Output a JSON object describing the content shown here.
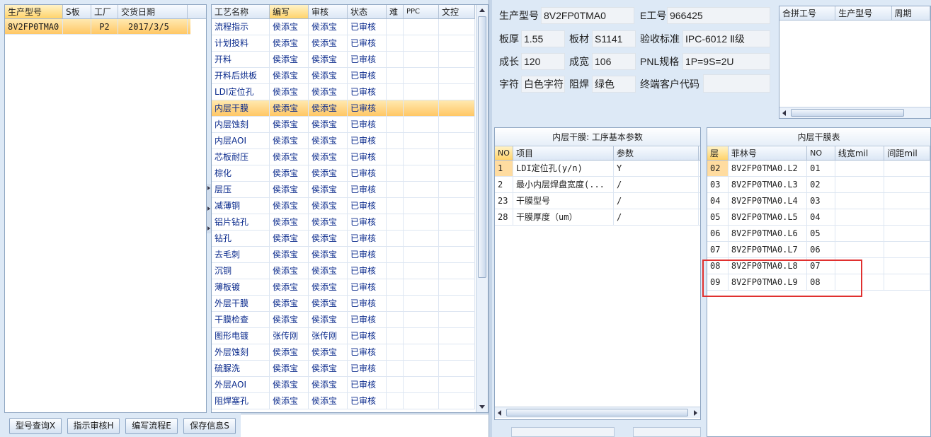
{
  "model_list": {
    "headers": [
      "生产型号",
      "S板",
      "工厂",
      "交货日期"
    ],
    "rows": [
      {
        "model": "8V2FP0TMA0",
        "s": "",
        "factory": "P2",
        "date": "2017/3/5"
      }
    ]
  },
  "process_list": {
    "headers": [
      "工艺名称",
      "编写",
      "审核",
      "状态",
      "难",
      "PPC",
      "文控"
    ],
    "rows": [
      [
        "流程指示",
        "侯添宝",
        "侯添宝",
        "已审核"
      ],
      [
        "计划投料",
        "侯添宝",
        "侯添宝",
        "已审核"
      ],
      [
        "开料",
        "侯添宝",
        "侯添宝",
        "已审核"
      ],
      [
        "开料后烘板",
        "侯添宝",
        "侯添宝",
        "已审核"
      ],
      [
        "LDI定位孔",
        "侯添宝",
        "侯添宝",
        "已审核"
      ],
      [
        "内层干膜",
        "侯添宝",
        "侯添宝",
        "已审核"
      ],
      [
        "内层蚀刻",
        "侯添宝",
        "侯添宝",
        "已审核"
      ],
      [
        "内层AOI",
        "侯添宝",
        "侯添宝",
        "已审核"
      ],
      [
        "芯板耐压",
        "侯添宝",
        "侯添宝",
        "已审核"
      ],
      [
        "棕化",
        "侯添宝",
        "侯添宝",
        "已审核"
      ],
      [
        "层压",
        "侯添宝",
        "侯添宝",
        "已审核"
      ],
      [
        "减薄铜",
        "侯添宝",
        "侯添宝",
        "已审核"
      ],
      [
        "铝片钻孔",
        "侯添宝",
        "侯添宝",
        "已审核"
      ],
      [
        "钻孔",
        "侯添宝",
        "侯添宝",
        "已审核"
      ],
      [
        "去毛刺",
        "侯添宝",
        "侯添宝",
        "已审核"
      ],
      [
        "沉铜",
        "侯添宝",
        "侯添宝",
        "已审核"
      ],
      [
        "薄板镀",
        "侯添宝",
        "侯添宝",
        "已审核"
      ],
      [
        "外层干膜",
        "侯添宝",
        "侯添宝",
        "已审核"
      ],
      [
        "干膜检查",
        "侯添宝",
        "侯添宝",
        "已审核"
      ],
      [
        "图形电镀",
        "张传刚",
        "张传刚",
        "已审核"
      ],
      [
        "外层蚀刻",
        "侯添宝",
        "侯添宝",
        "已审核"
      ],
      [
        "硫脲洗",
        "侯添宝",
        "侯添宝",
        "已审核"
      ],
      [
        "外层AOI",
        "侯添宝",
        "侯添宝",
        "已审核"
      ],
      [
        "阻焊塞孔",
        "侯添宝",
        "侯添宝",
        "已审核"
      ]
    ]
  },
  "info": {
    "model_label": "生产型号",
    "model_value": "8V2FP0TMA0",
    "eno_label": "E工号",
    "eno_value": "966425",
    "thickness_label": "板厚",
    "thickness_value": "1.55",
    "material_label": "板材",
    "material_value": "S1141",
    "standard_label": "验收标准",
    "standard_value": "IPC-6012 Ⅱ级",
    "length_label": "成长",
    "length_value": "120",
    "width_label": "成宽",
    "width_value": "106",
    "pnl_label": "PNL规格",
    "pnl_value": "1P=9S=2U",
    "char_label": "字符",
    "char_value": "白色字符",
    "mask_label": "阻焊",
    "mask_value": "绿色",
    "customer_label": "终端客户代码",
    "customer_value": ""
  },
  "merge_table": {
    "headers": [
      "合拼工号",
      "生产型号",
      "周期"
    ]
  },
  "params_panel": {
    "title": "内层干膜: 工序基本参数",
    "headers": [
      "NO",
      "项目",
      "参数"
    ],
    "rows": [
      [
        "1",
        "LDI定位孔(y/n)",
        "Y"
      ],
      [
        "2",
        "最小内层焊盘宽度(...",
        "/"
      ],
      [
        "23",
        "干膜型号",
        "/"
      ],
      [
        "28",
        "干膜厚度（um）",
        "/"
      ]
    ]
  },
  "layer_panel": {
    "title": "内层干膜表",
    "headers": [
      "层",
      "菲林号",
      "NO",
      "线宽mil",
      "间距mil"
    ],
    "rows": [
      [
        "02",
        "8V2FP0TMA0.L2",
        "01"
      ],
      [
        "03",
        "8V2FP0TMA0.L3",
        "02"
      ],
      [
        "04",
        "8V2FP0TMA0.L4",
        "03"
      ],
      [
        "05",
        "8V2FP0TMA0.L5",
        "04"
      ],
      [
        "06",
        "8V2FP0TMA0.L6",
        "05"
      ],
      [
        "07",
        "8V2FP0TMA0.L7",
        "06"
      ],
      [
        "08",
        "8V2FP0TMA0.L8",
        "07"
      ],
      [
        "09",
        "8V2FP0TMA0.L9",
        "08"
      ]
    ]
  },
  "buttons": {
    "query": "型号查询X",
    "review": "指示审核H",
    "write": "编写流程E",
    "save": "保存信息S"
  },
  "colors": {
    "selection": "#ffc765",
    "highlight_box": "#e0302f",
    "text_blue": "#0a2a8c"
  }
}
